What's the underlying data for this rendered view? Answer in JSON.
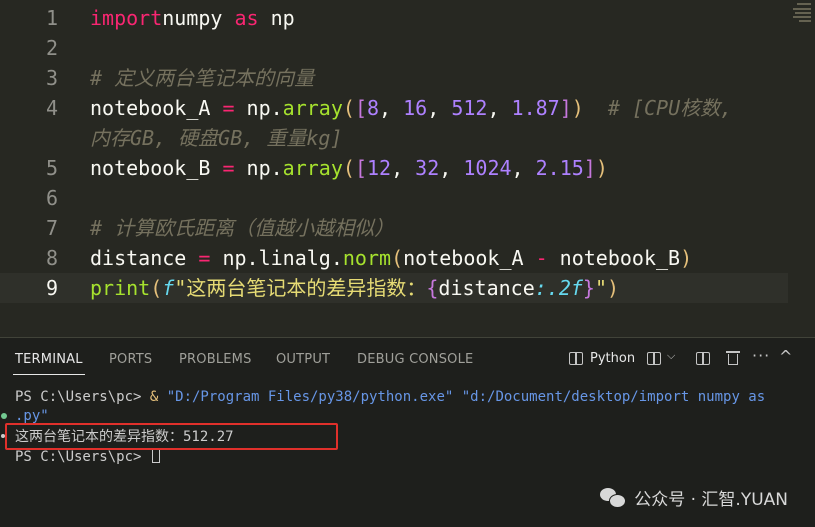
{
  "editor": {
    "lines": [
      {
        "n": "1",
        "tokens": [
          [
            "kw",
            "import"
          ],
          [
            "",
            "numpy "
          ],
          [
            "kw",
            "as"
          ],
          [
            "",
            " np"
          ]
        ]
      },
      {
        "n": "2",
        "tokens": []
      },
      {
        "n": "3",
        "tokens": [
          [
            "cmt",
            "# 定义两台笔记本的向量"
          ]
        ]
      },
      {
        "n": "4",
        "tokens": [
          [
            "",
            "notebook_A "
          ],
          [
            "op",
            "="
          ],
          [
            "",
            " np."
          ],
          [
            "fn",
            "array"
          ],
          [
            "br1",
            "("
          ],
          [
            "br2",
            "["
          ],
          [
            "num",
            "8"
          ],
          [
            "",
            ", "
          ],
          [
            "num",
            "16"
          ],
          [
            "",
            ", "
          ],
          [
            "num",
            "512"
          ],
          [
            "",
            ", "
          ],
          [
            "num",
            "1.87"
          ],
          [
            "br2",
            "]"
          ],
          [
            "br1",
            ")"
          ],
          [
            "",
            "  "
          ],
          [
            "cmt",
            "# [CPU核数,"
          ]
        ]
      },
      {
        "n": "",
        "tokens": [
          [
            "cmt",
            "内存GB, 硬盘GB, 重量kg]"
          ]
        ]
      },
      {
        "n": "5",
        "tokens": [
          [
            "",
            "notebook_B "
          ],
          [
            "op",
            "="
          ],
          [
            "",
            " np."
          ],
          [
            "fn",
            "array"
          ],
          [
            "br1",
            "("
          ],
          [
            "br2",
            "["
          ],
          [
            "num",
            "12"
          ],
          [
            "",
            ", "
          ],
          [
            "num",
            "32"
          ],
          [
            "",
            ", "
          ],
          [
            "num",
            "1024"
          ],
          [
            "",
            ", "
          ],
          [
            "num",
            "2.15"
          ],
          [
            "br2",
            "]"
          ],
          [
            "br1",
            ")"
          ]
        ]
      },
      {
        "n": "6",
        "tokens": []
      },
      {
        "n": "7",
        "tokens": [
          [
            "cmt",
            "# 计算欧氏距离（值越小越相似）"
          ]
        ]
      },
      {
        "n": "8",
        "tokens": [
          [
            "",
            "distance "
          ],
          [
            "op",
            "="
          ],
          [
            "",
            " np."
          ],
          [
            "",
            "linalg"
          ],
          [
            "",
            "."
          ],
          [
            "fn",
            "norm"
          ],
          [
            "br1",
            "("
          ],
          [
            "",
            "notebook_A "
          ],
          [
            "op",
            "-"
          ],
          [
            "",
            " notebook_B"
          ],
          [
            "br1",
            ")"
          ]
        ]
      },
      {
        "n": "9",
        "current": true,
        "tokens": [
          [
            "fn",
            "print"
          ],
          [
            "br1",
            "("
          ],
          [
            "fpre",
            "f"
          ],
          [
            "str",
            "\"这两台笔记本的差异指数："
          ],
          [
            "br2",
            "{"
          ],
          [
            "",
            "distance"
          ],
          [
            "fmt",
            ":.2f"
          ],
          [
            "br2",
            "}"
          ],
          [
            "str",
            "\""
          ],
          [
            "br1",
            ")"
          ]
        ]
      }
    ]
  },
  "panel": {
    "tabs": [
      "TERMINAL",
      "PORTS",
      "PROBLEMS",
      "OUTPUT",
      "DEBUG CONSOLE"
    ],
    "active_tab": "TERMINAL",
    "shell_label": "Python",
    "terminal": {
      "prompt1": "PS C:\\Users\\pc> ",
      "amp": "& ",
      "exe": "\"D:/Program Files/py38/python.exe\" ",
      "script": "\"d:/Document/desktop/import numpy as",
      "script_cont": ".py\"",
      "output": "这两台笔记本的差异指数：512.27",
      "prompt2": "PS C:\\Users\\pc> "
    }
  },
  "watermark": {
    "text": "公众号 · 汇智.YUAN"
  },
  "colors": {
    "highlight_border": "#e0302b",
    "success_dot": "#73c991"
  }
}
